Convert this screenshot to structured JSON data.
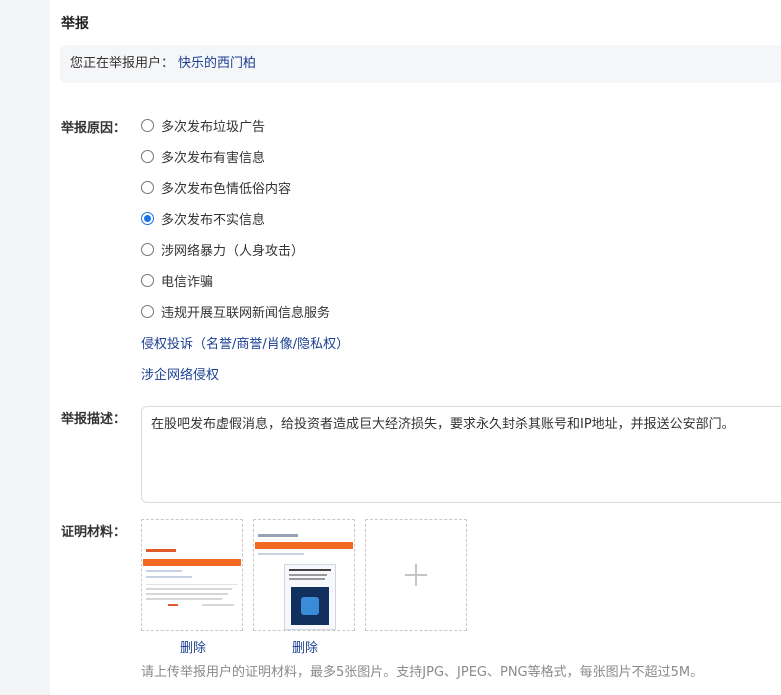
{
  "panel": {
    "title": "举报",
    "target_prefix": "您正在举报用户：",
    "target_user": "快乐的西门柏"
  },
  "reasons": {
    "label": "举报原因：",
    "options": [
      {
        "label": "多次发布垃圾广告",
        "checked": false
      },
      {
        "label": "多次发布有害信息",
        "checked": false
      },
      {
        "label": "多次发布色情低俗内容",
        "checked": false
      },
      {
        "label": "多次发布不实信息",
        "checked": true
      },
      {
        "label": "涉网络暴力（人身攻击）",
        "checked": false
      },
      {
        "label": "电信诈骗",
        "checked": false
      },
      {
        "label": "违规开展互联网新闻信息服务",
        "checked": false
      }
    ],
    "links": [
      "侵权投诉（名誉/商誉/肖像/隐私权）",
      "涉企网络侵权"
    ]
  },
  "description": {
    "label": "举报描述：",
    "value": "在股吧发布虚假消息，给投资者造成巨大经济损失，要求永久封杀其账号和IP地址，并报送公安部门。"
  },
  "evidence": {
    "label": "证明材料：",
    "delete_label": "删除",
    "add_icon": "plus-icon",
    "hint": "请上传举报用户的证明材料，最多5张图片。支持JPG、JPEG、PNG等格式，每张图片不超过5M。"
  },
  "colors": {
    "link": "#1c3f94",
    "accent": "#1a73e8",
    "thumb_banner": "#f26a21"
  }
}
